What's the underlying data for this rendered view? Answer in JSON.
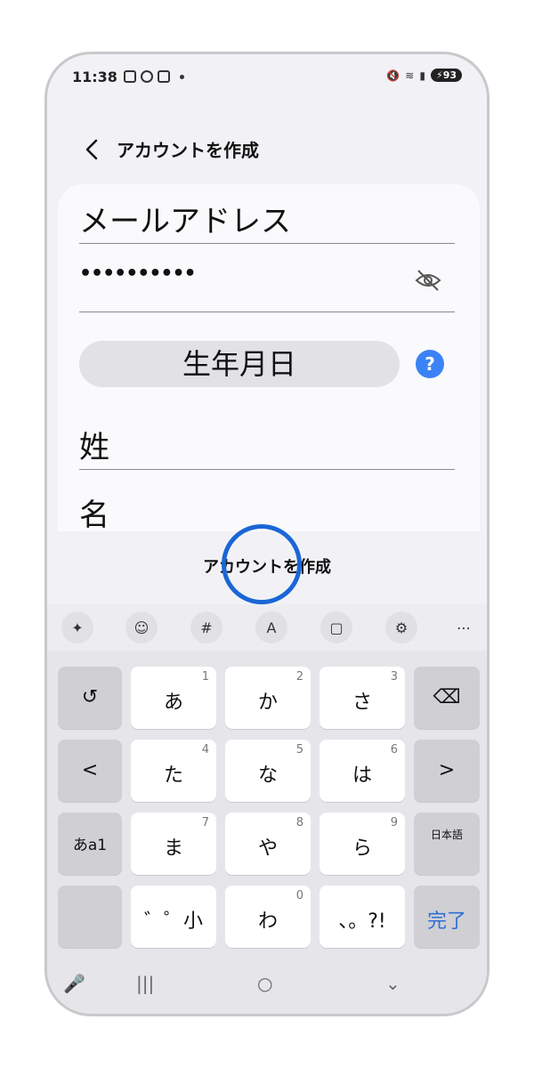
{
  "status": {
    "time": "11:38",
    "battery": "93"
  },
  "header": {
    "title": "アカウントを作成"
  },
  "form": {
    "email_label": "メールアドレス",
    "password_value": "••••••••••",
    "birthday_label": "生年月日",
    "help_label": "?",
    "last_name_label": "姓",
    "first_name_label": "名"
  },
  "action": {
    "create_account": "アカウントを作成"
  },
  "keyboard": {
    "toolbar": [
      "sparkle-icon",
      "emoji-icon",
      "symbols-icon",
      "translate-icon",
      "clipboard-icon",
      "settings-icon",
      "more-icon"
    ],
    "keys": {
      "undo": "↺",
      "a": "あ",
      "a_num": "1",
      "ka": "か",
      "ka_num": "2",
      "sa": "さ",
      "sa_num": "3",
      "backspace": "⌫",
      "left": "<",
      "ta": "た",
      "ta_num": "4",
      "na": "な",
      "na_num": "5",
      "ha": "は",
      "ha_num": "6",
      "right": ">",
      "mode": "あa1",
      "ma": "ま",
      "ma_num": "7",
      "ya": "や",
      "ya_num": "8",
      "ra": "ら",
      "ra_num": "9",
      "lang": "日本語",
      "dakuten": "゛゜小",
      "wa": "わ",
      "wa_num": "0",
      "punct": "、。?!",
      "done": "完了"
    }
  },
  "colors": {
    "accent": "#3b82f6",
    "done_text": "#2f6fd6",
    "tap_ring": "#1a66d6"
  }
}
